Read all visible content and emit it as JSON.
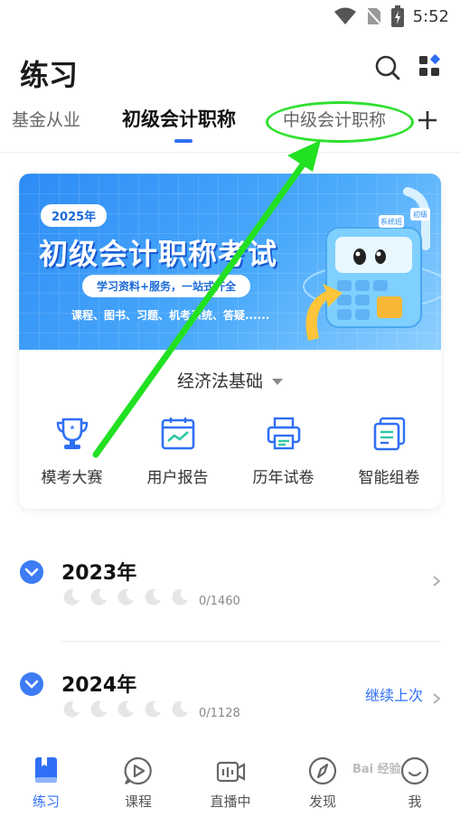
{
  "status_bar": {
    "time": "5:52"
  },
  "header": {
    "title": "练习"
  },
  "tabs": [
    {
      "label": "基金从业"
    },
    {
      "label": "初级会计职称"
    },
    {
      "label": "中级会计职称"
    }
  ],
  "banner": {
    "year": "2025年",
    "title": "初级会计职称考试",
    "subtitle": "学习资料+服务，一站式齐全",
    "desc": "课程、图书、习题、机考系统、答疑......",
    "art_tags": [
      "系统班",
      "初级"
    ]
  },
  "subject": {
    "selected": "经济法基础"
  },
  "quick_actions": [
    {
      "label": "模考大赛",
      "icon": "trophy-icon"
    },
    {
      "label": "用户报告",
      "icon": "report-chart-icon"
    },
    {
      "label": "历年试卷",
      "icon": "printer-icon"
    },
    {
      "label": "智能组卷",
      "icon": "papers-icon"
    }
  ],
  "years": [
    {
      "title": "2023年",
      "count": "0/1460",
      "action": ""
    },
    {
      "title": "2024年",
      "count": "0/1128",
      "action": "继续上次"
    }
  ],
  "bottom_nav": [
    {
      "label": "练习",
      "icon": "book-icon",
      "active": true
    },
    {
      "label": "课程",
      "icon": "play-bubble-icon",
      "active": false
    },
    {
      "label": "直播中",
      "icon": "live-camera-icon",
      "active": false
    },
    {
      "label": "发现",
      "icon": "compass-icon",
      "active": false
    },
    {
      "label": "我",
      "icon": "smile-icon",
      "active": false
    }
  ],
  "watermark": "Bai 经验",
  "colors": {
    "accent": "#2f6ff5",
    "annotation": "#2ee02e",
    "banner": "#2d8cf5"
  }
}
